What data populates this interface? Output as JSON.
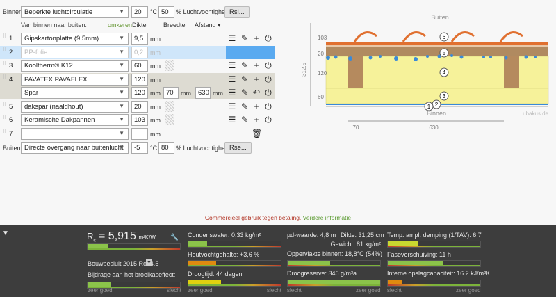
{
  "binnen": {
    "label": "Binnen:",
    "climate": "Beperkte luchtcirculatie",
    "temp": "20",
    "temp_unit": "°C",
    "rh": "50",
    "rh_unit": "% Luchtvochtigheid",
    "button": "Rsi..."
  },
  "buiten": {
    "label": "Buiten:",
    "climate": "Directe overgang naar buitenlucht",
    "temp": "-5",
    "temp_unit": "°C",
    "rh": "80",
    "rh_unit": "% Luchtvochtigheid",
    "button": "Rse..."
  },
  "header": {
    "direction": "Van binnen naar buiten:",
    "reverse": "omkeren",
    "thickness": "Dikte",
    "width": "Breedte",
    "spacing": "Afstand ▾"
  },
  "layers": [
    {
      "num": "1",
      "material": "Gipskartonplatte (9,5mm)",
      "thickness": "9,5",
      "unit": "mm"
    },
    {
      "num": "2",
      "material": "PP-folie",
      "thickness": "0,2",
      "unit": "mm",
      "disabled": true
    },
    {
      "num": "3",
      "material": "Kooltherm® K12",
      "thickness": "60",
      "unit": "mm"
    },
    {
      "num": "4",
      "material": "PAVATEX PAVAFLEX",
      "thickness": "120",
      "unit": "mm"
    },
    {
      "num": "",
      "material": "Spar",
      "thickness": "120",
      "unit": "mm",
      "width": "70",
      "width_unit": "mm",
      "spacing": "630",
      "spacing_unit": "mm"
    },
    {
      "num": "5",
      "material": "dakspar (naaldhout)",
      "thickness": "20",
      "unit": "mm"
    },
    {
      "num": "6",
      "material": "Keramische Dakpannen",
      "thickness": "103",
      "unit": "mm"
    },
    {
      "num": "7",
      "material": "",
      "thickness": "",
      "unit": "mm"
    }
  ],
  "diagram": {
    "top": "Buiten",
    "bottom": "Binnen",
    "brand": "ubakus.de",
    "total": "312,5",
    "dims": [
      "103",
      "20",
      "120",
      "60"
    ],
    "widths": [
      "70",
      "630"
    ],
    "markers": [
      "6",
      "5",
      "4",
      "3",
      "2",
      "1"
    ],
    "colors": {
      "tile": "#e07030",
      "wood": "#b08a60",
      "insulation": "#f6f29a",
      "membrane": "#3a8ad8"
    }
  },
  "notice": {
    "text": "Commercieel gebruik tegen betaling.",
    "link": "Verdere informatie"
  },
  "results": {
    "rc_label": "R",
    "rc_sub": "c",
    "rc_value": "= 5,915",
    "rc_unit": "m²K/W",
    "rc_fraction": 0.22,
    "standard": "Bouwbesluit 2015 Rc>4.5",
    "greenhouse": "Bijdrage aan het broeikaseffect:",
    "greenhouse_fraction": 0.25,
    "good": "zeer goed",
    "bad": "slecht",
    "condensate": "Condenswater: 0,33 kg/m²",
    "condensate_fraction": 0.2,
    "wood_moisture": "Houtvochtgehalte: +3,6 %",
    "wood_moisture_fraction": 0.3,
    "drying_time": "Droogtijd: 44 dagen",
    "drying_time_fraction": 0.35,
    "sd": "µd-waarde: 4,8 m",
    "thickness": "Dikte: 31,25 cm",
    "weight": "Gewicht: 81 kg/m²",
    "surface": "Oppervlakte binnen: 18,8°C (54%)",
    "surface_fraction": 0.46,
    "drying_reserve": "Droogreserve: 346 g/m²a",
    "drying_reserve_fraction": 1.0,
    "temp_damping": "Temp. ampl. demping (1/TAV): 6,7",
    "temp_damping_fraction": 0.33,
    "phase_shift": "Faseverschuiving: 11 h",
    "phase_shift_fraction": 0.6,
    "heat_capacity": "Interne opslagcapaciteit: 16.2 kJ/m²K",
    "heat_capacity_fraction": 0.16
  }
}
